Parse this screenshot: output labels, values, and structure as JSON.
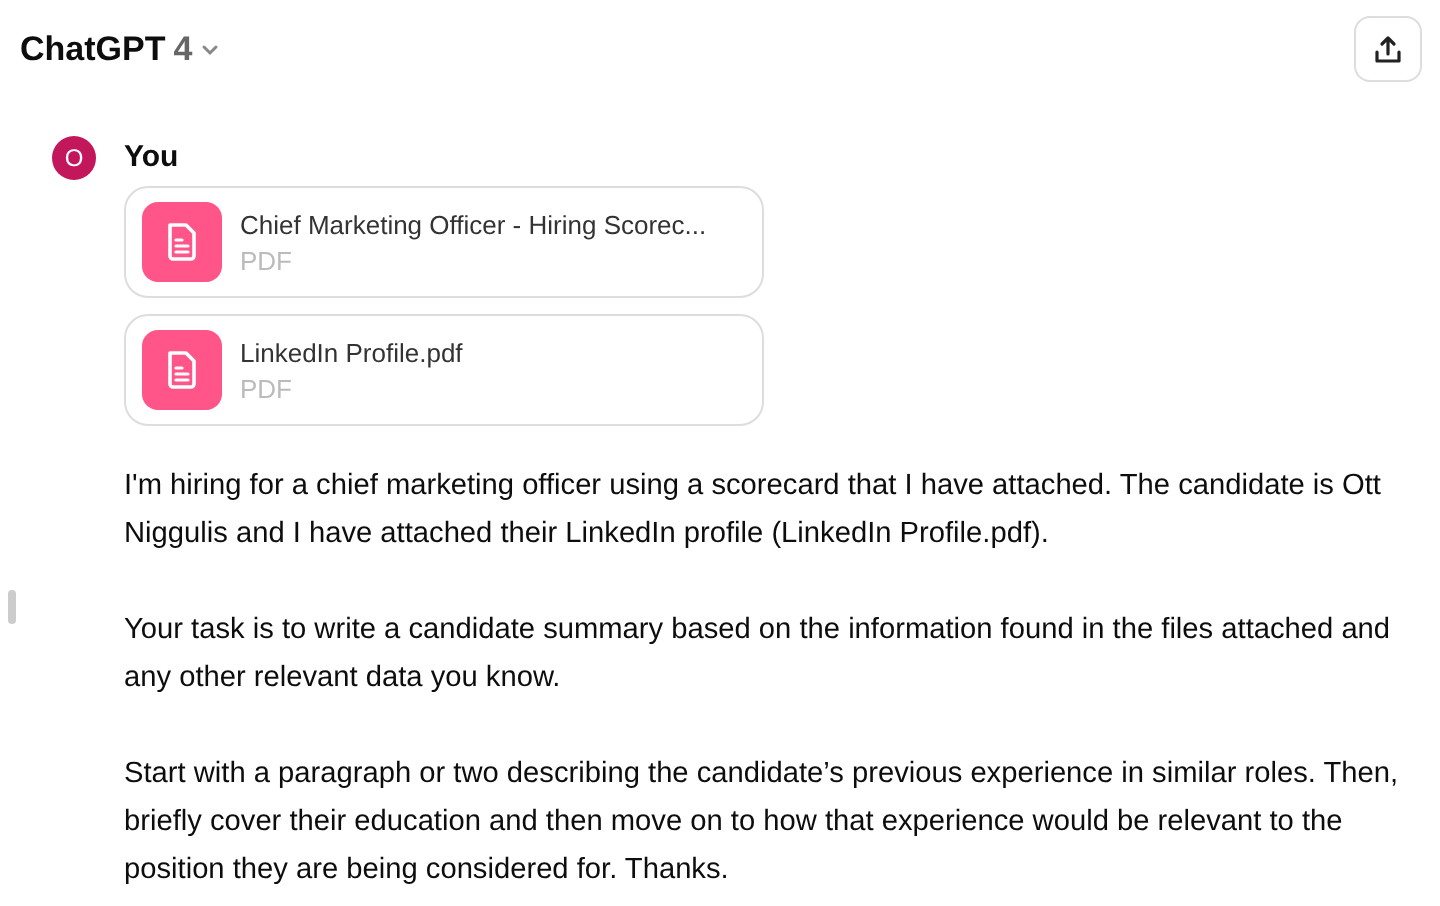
{
  "header": {
    "title": "ChatGPT",
    "version": "4"
  },
  "message": {
    "avatar": "O",
    "author": "You",
    "attachments": [
      {
        "name": "Chief Marketing Officer - Hiring Scorec...",
        "type": "PDF"
      },
      {
        "name": "LinkedIn Profile.pdf",
        "type": "PDF"
      }
    ],
    "paragraphs": [
      "I'm hiring for a chief marketing officer using a scorecard that I have attached. The candidate is Ott Niggulis and I have attached their LinkedIn profile (LinkedIn Profile.pdf).",
      "Your task is to write a candidate summary based on the information found in the files attached and any other relevant data you know.",
      "Start with a paragraph or two describing the candidate’s previous experience in similar roles. Then, briefly cover their education and then move on to how that experience would be relevant to the position they are being considered for. Thanks."
    ]
  }
}
